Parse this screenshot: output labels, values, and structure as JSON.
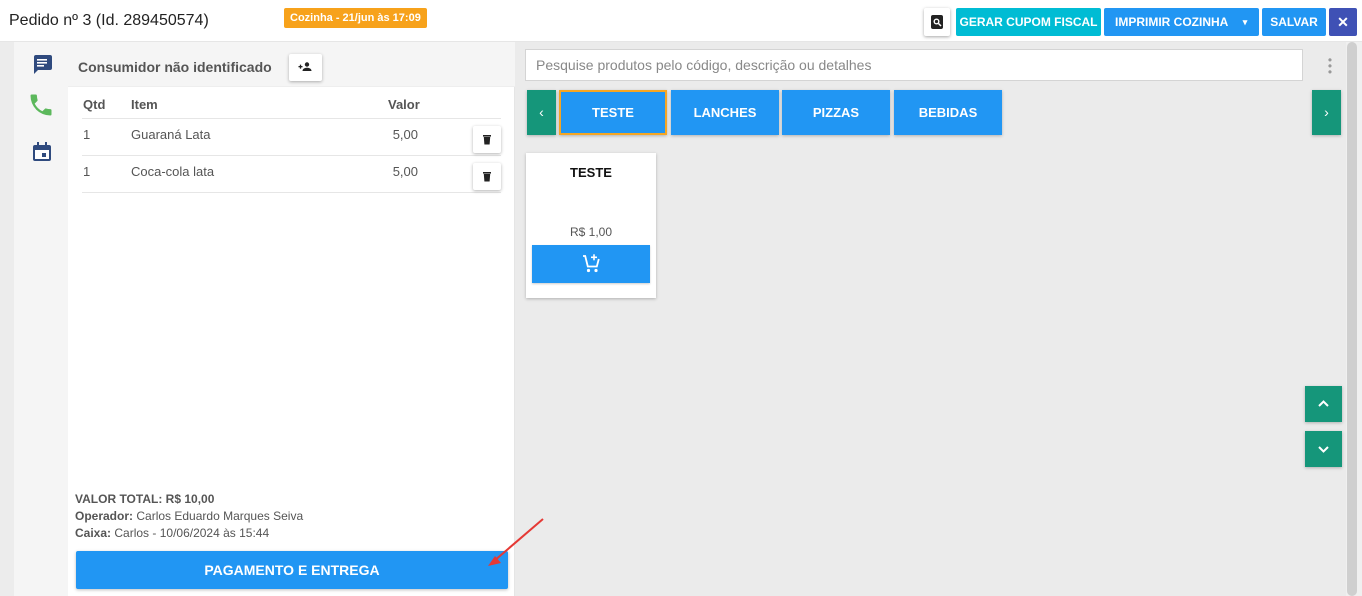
{
  "header": {
    "title": "Pedido nº 3 (Id. 289450574)",
    "badge": "Cozinha - 21/jun às 17:09",
    "buttons": {
      "preview_icon": "search-document-icon",
      "cupom": "GERAR CUPOM FISCAL",
      "cozinha": "IMPRIMIR COZINHA",
      "cozinha_caret": "▾",
      "salvar": "SALVAR",
      "close": "✕"
    }
  },
  "sidebar": {
    "icons": [
      "chat-icon",
      "phone-icon",
      "calendar-icon"
    ]
  },
  "order": {
    "consumer": "Consumidor não identificado",
    "columns": {
      "qty": "Qtd",
      "item": "Item",
      "value": "Valor"
    },
    "items": [
      {
        "qty": "1",
        "item": "Guaraná Lata",
        "value": "5,00"
      },
      {
        "qty": "1",
        "item": "Coca-cola lata",
        "value": "5,00"
      }
    ],
    "total_label": "VALOR TOTAL:",
    "total_value": "R$ 10,00",
    "operator_label": "Operador:",
    "operator_value": "Carlos Eduardo Marques Seiva",
    "cashier_label": "Caixa:",
    "cashier_value": "Carlos - 10/06/2024 às 15:44",
    "pay_button": "PAGAMENTO E ENTREGA"
  },
  "products": {
    "search_placeholder": "Pesquise produtos pelo código, descrição ou detalhes",
    "prev": "‹",
    "next": "›",
    "categories": [
      {
        "label": "TESTE",
        "active": true
      },
      {
        "label": "LANCHES",
        "active": false
      },
      {
        "label": "PIZZAS",
        "active": false
      },
      {
        "label": "BEBIDAS",
        "active": false
      }
    ],
    "cards": [
      {
        "name": "TESTE",
        "price": "R$ 1,00",
        "add_icon": "add-cart-icon"
      }
    ]
  },
  "colors": {
    "primary": "#2196f3",
    "teal": "#15967a",
    "cyan": "#00bcd4",
    "indigo": "#3f51b5",
    "orange": "#f7a21b",
    "annotation_arrow": "#e53935"
  }
}
